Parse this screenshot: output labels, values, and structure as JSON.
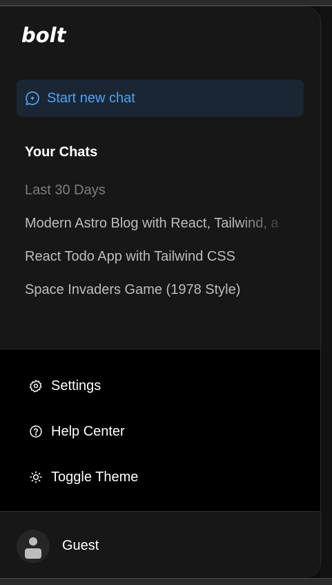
{
  "brand": {
    "logo_text": "bolt"
  },
  "new_chat": {
    "label": "Start new chat",
    "icon": "chat-sparkle-icon",
    "accent": "#4ea3f2"
  },
  "chats": {
    "section_title": "Your Chats",
    "group_label": "Last 30 Days",
    "items": [
      "Modern Astro Blog with React, Tailwind, a",
      "React Todo App with Tailwind CSS",
      "Space Invaders Game (1978 Style)"
    ]
  },
  "menu": {
    "settings": {
      "label": "Settings",
      "icon": "gear-icon"
    },
    "help": {
      "label": "Help Center",
      "icon": "help-circle-icon"
    },
    "theme": {
      "label": "Toggle Theme",
      "icon": "sun-icon"
    }
  },
  "user": {
    "name": "Guest",
    "icon": "user-avatar-icon"
  }
}
